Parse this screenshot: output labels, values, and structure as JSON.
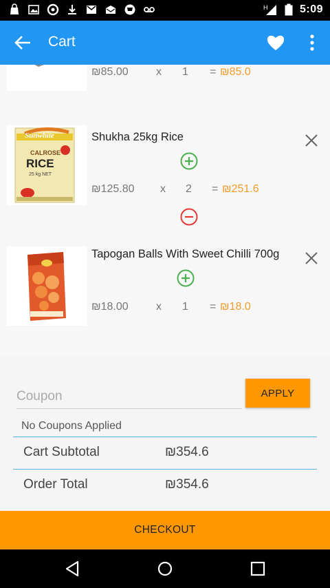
{
  "status_bar": {
    "time": "5:09",
    "network": "H",
    "icons": [
      "shopping-bag-icon",
      "image-icon",
      "circle-app-icon",
      "download-icon",
      "gmail-icon",
      "email-icon",
      "cart-notification-icon",
      "voicemail-icon",
      "signal-icon",
      "battery-icon"
    ]
  },
  "app_bar": {
    "title": "Cart",
    "color": "#2196f3"
  },
  "cart": {
    "items": [
      {
        "name": "",
        "unit_price": "₪85.00",
        "x": "x",
        "qty": "1",
        "eq": "=",
        "total": "₪85.0"
      },
      {
        "name": "Shukha 25kg Rice",
        "unit_price": "₪125.80",
        "x": "x",
        "qty": "2",
        "eq": "=",
        "total": "₪251.6",
        "thumb_brand": "Sunwhite",
        "thumb_line1": "CALROSE",
        "thumb_line2": "RICE",
        "thumb_line3": "25 kg NET"
      },
      {
        "name": "Tapogan Balls With Sweet Chilli 700g",
        "unit_price": "₪18.00",
        "x": "x",
        "qty": "1",
        "eq": "=",
        "total": "₪18.0"
      }
    ]
  },
  "coupon": {
    "placeholder": "Coupon",
    "apply_label": "APPLY",
    "status": "No Coupons Applied"
  },
  "summary": {
    "subtotal_label": "Cart Subtotal",
    "subtotal_value": "₪354.6",
    "total_label": "Order Total",
    "total_value": "₪354.6"
  },
  "checkout_label": "CHECKOUT",
  "colors": {
    "accent": "#ff9800",
    "price_total": "#f39c2a",
    "add": "#4caf50",
    "remove": "#e53935",
    "divider": "#5bb6e8"
  }
}
